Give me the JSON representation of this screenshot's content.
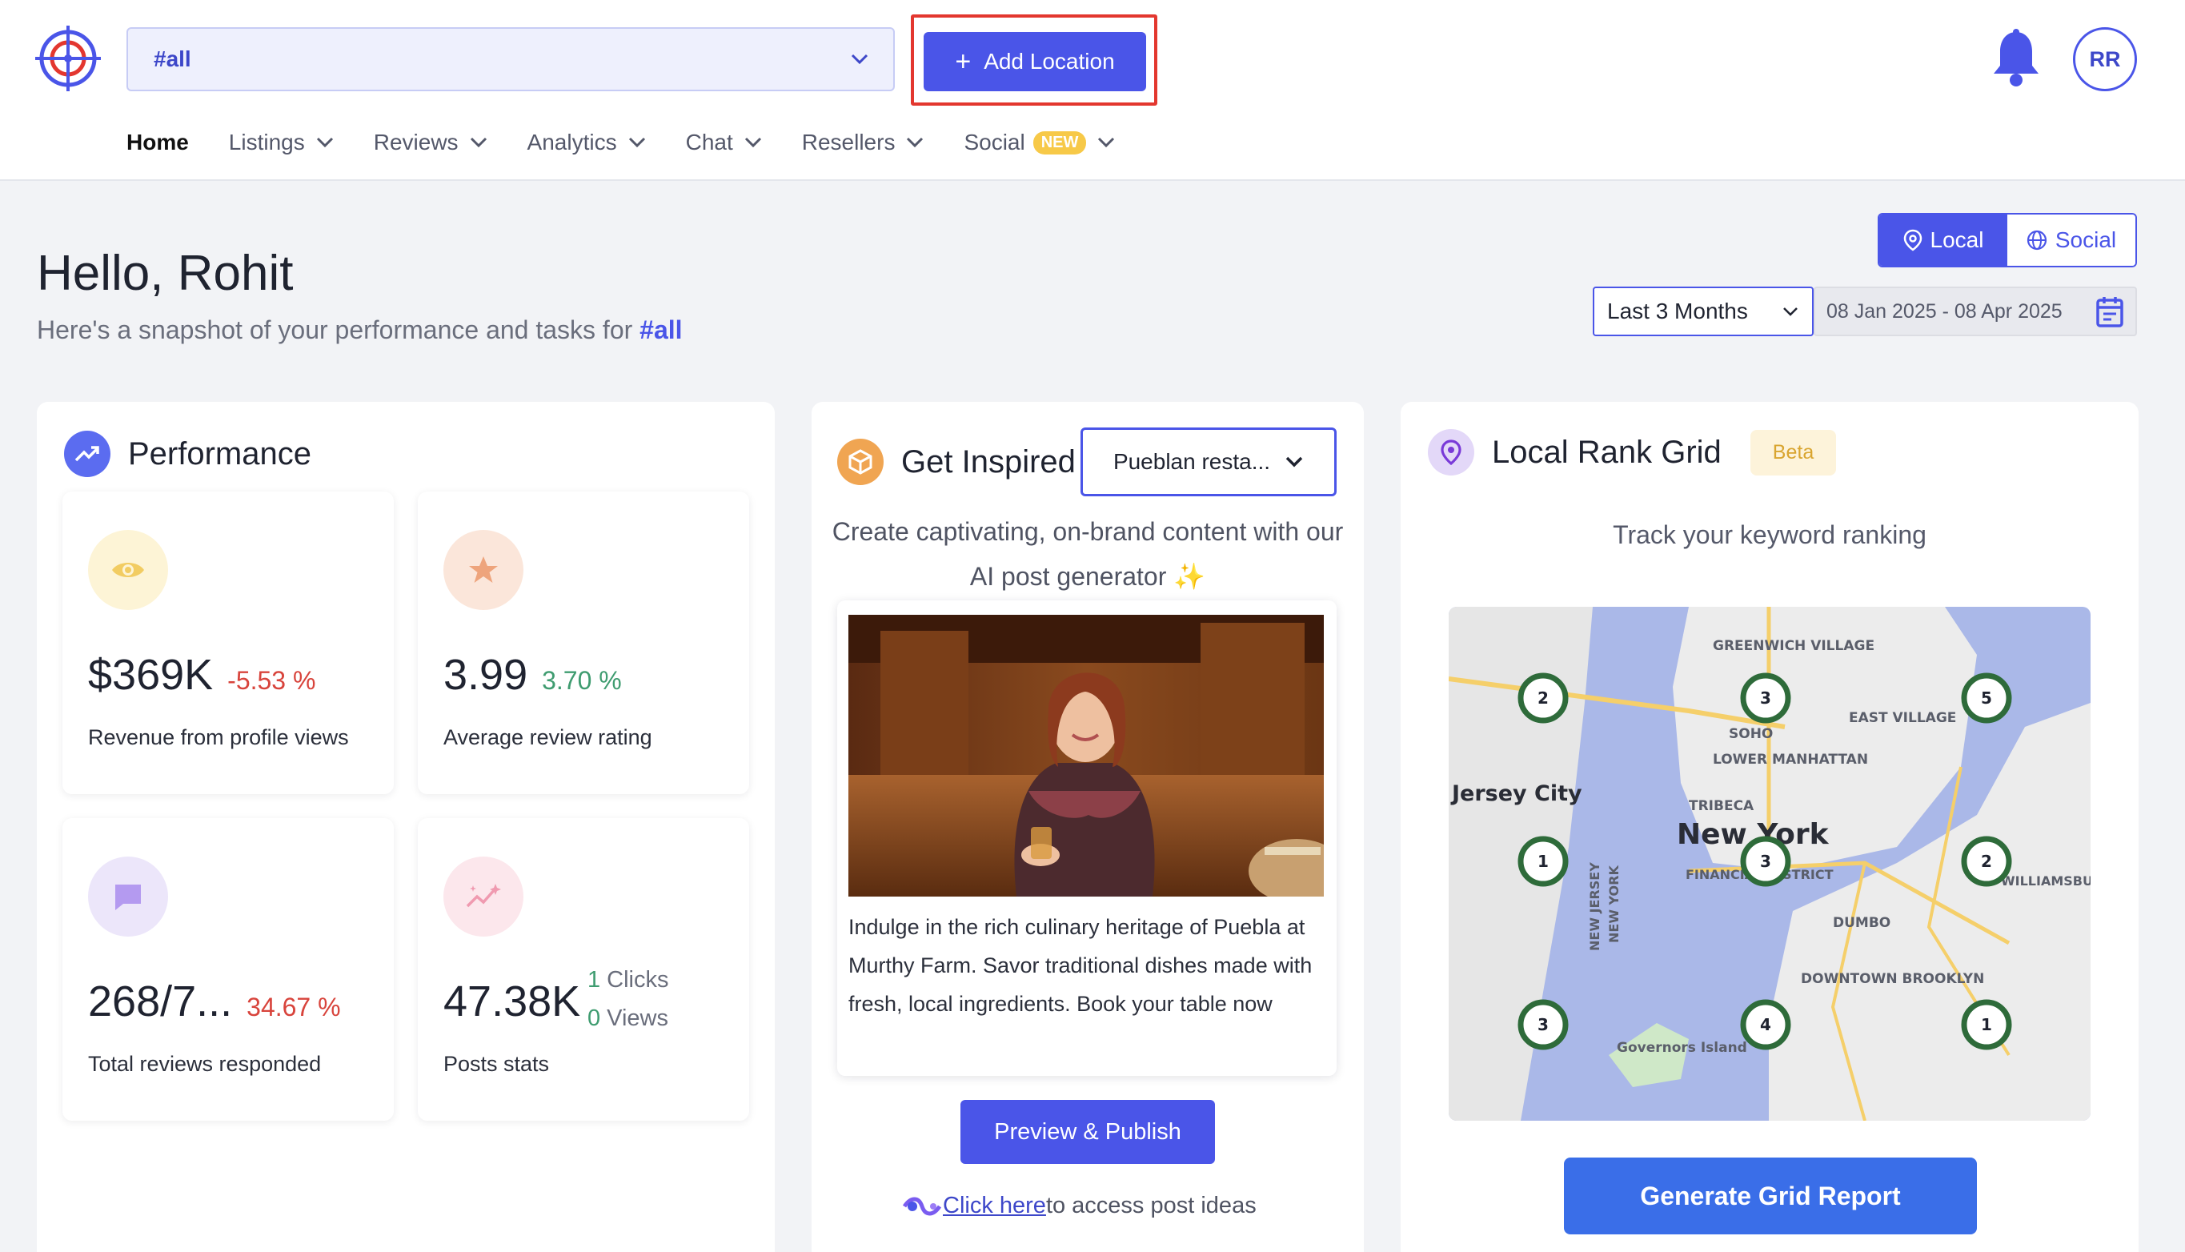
{
  "header": {
    "location_select": {
      "value": "#all"
    },
    "add_location_label": "Add Location",
    "avatar_initials": "RR",
    "nav": [
      {
        "label": "Home",
        "active": true,
        "has_dropdown": false
      },
      {
        "label": "Listings",
        "has_dropdown": true
      },
      {
        "label": "Reviews",
        "has_dropdown": true
      },
      {
        "label": "Analytics",
        "has_dropdown": true
      },
      {
        "label": "Chat",
        "has_dropdown": true
      },
      {
        "label": "Resellers",
        "has_dropdown": true
      },
      {
        "label": "Social",
        "badge": "NEW",
        "has_dropdown": true
      }
    ]
  },
  "greeting": {
    "title": "Hello, Rohit",
    "subtitle_prefix": "Here's a snapshot of your performance and tasks for",
    "subtitle_tag": "#all"
  },
  "view_toggle": {
    "local": "Local",
    "social": "Social",
    "selected": "Local"
  },
  "date_filter": {
    "range_label": "Last 3 Months",
    "dates": "08 Jan 2025 - 08 Apr 2025"
  },
  "performance": {
    "title": "Performance",
    "stats": [
      {
        "value": "$369K",
        "change": "-5.53 %",
        "trend": "negative",
        "caption": "Revenue from profile views",
        "icon": "eye-icon"
      },
      {
        "value": "3.99",
        "change": "3.70 %",
        "trend": "positive",
        "caption": "Average review rating",
        "icon": "star-icon"
      },
      {
        "value": "268/7...",
        "change": "34.67 %",
        "trend": "negative",
        "caption": "Total reviews responded",
        "icon": "chat-icon"
      },
      {
        "value": "47.38K",
        "caption": "Posts stats",
        "icon": "sparkle-chart-icon",
        "clicks_n": "1",
        "clicks_label": "Clicks",
        "views_n": "0",
        "views_label": "Views"
      }
    ]
  },
  "inspired": {
    "title": "Get Inspired",
    "category_select": "Pueblan resta...",
    "description": "Create captivating, on-brand content with our AI post generator",
    "post_text": "Indulge in the rich culinary heritage of Puebla at Murthy Farm. Savor traditional dishes made with fresh, local ingredients. Book your table now",
    "publish_label": "Preview & Publish",
    "ideas_link": "Click here",
    "ideas_suffix": " to access post ideas"
  },
  "rank_grid": {
    "title": "Local Rank Grid",
    "badge": "Beta",
    "subtitle": "Track your keyword ranking",
    "button": "Generate Grid Report",
    "map_labels": [
      "GREENWICH VILLAGE",
      "SOHO",
      "EAST VILLAGE",
      "LOWER MANHATTAN",
      "TRIBECA",
      "New York",
      "FINANCIAL DISTRICT",
      "Jersey City",
      "DUMBO",
      "DOWNTOWN BROOKLYN",
      "Governors Island",
      "WILLIAMSBURG",
      "NEW JERSEY",
      "NEW YORK"
    ],
    "pins": [
      2,
      3,
      5,
      1,
      3,
      2,
      3,
      4,
      1
    ]
  },
  "colors": {
    "primary": "#4a55e8",
    "danger": "#d8443c",
    "success": "#3f9c70",
    "highlight_border": "#e3372f"
  }
}
